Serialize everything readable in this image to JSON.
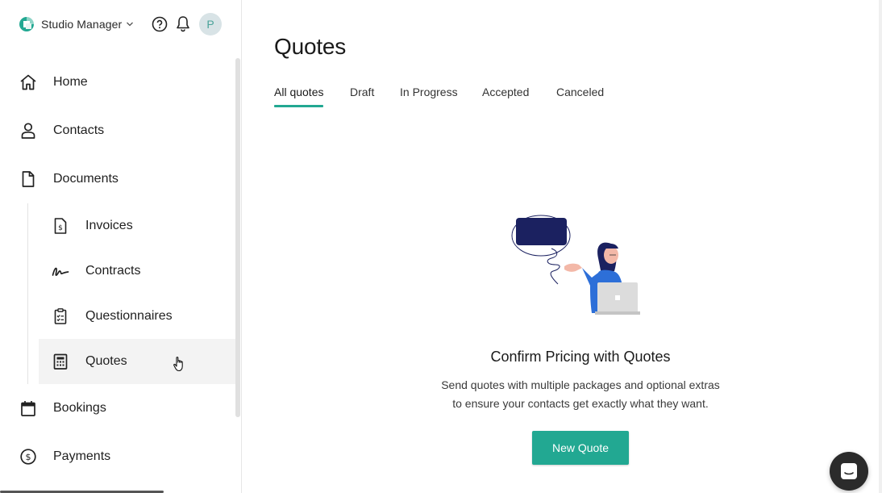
{
  "header": {
    "workspace_name": "Studio Manager",
    "avatar_initial": "P"
  },
  "sidebar": {
    "items": [
      {
        "label": "Home",
        "icon": "home-icon"
      },
      {
        "label": "Contacts",
        "icon": "user-icon"
      },
      {
        "label": "Documents",
        "icon": "document-icon"
      },
      {
        "label": "Invoices",
        "icon": "invoice-icon"
      },
      {
        "label": "Contracts",
        "icon": "signature-icon"
      },
      {
        "label": "Questionnaires",
        "icon": "clipboard-icon"
      },
      {
        "label": "Quotes",
        "icon": "calculator-icon",
        "active": true
      },
      {
        "label": "Bookings",
        "icon": "calendar-icon"
      },
      {
        "label": "Payments",
        "icon": "dollar-icon"
      }
    ]
  },
  "main": {
    "title": "Quotes",
    "tabs": [
      {
        "label": "All quotes",
        "active": true
      },
      {
        "label": "Draft"
      },
      {
        "label": "In Progress"
      },
      {
        "label": "Accepted"
      },
      {
        "label": "Canceled"
      }
    ],
    "empty_state": {
      "title": "Confirm Pricing with Quotes",
      "description": "Send quotes with multiple packages and optional extras to ensure your contacts get exactly what they want.",
      "button_label": "New Quote"
    }
  },
  "colors": {
    "accent": "#22a892",
    "speech_bubble": "#1b2160",
    "avatar_bg": "#d8e3e6"
  }
}
